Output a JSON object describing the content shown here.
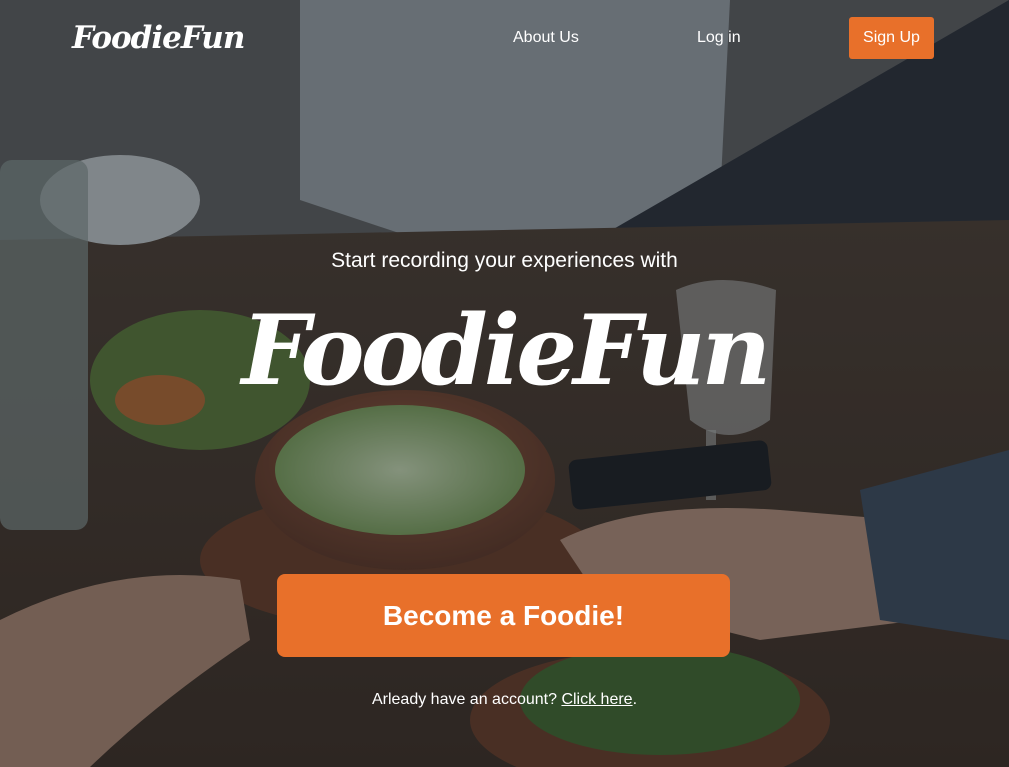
{
  "brand": {
    "name": "FoodieFun",
    "accent_color": "#e8702a",
    "text_color": "#ffffff"
  },
  "nav": {
    "about_label": "About Us",
    "login_label": "Log in",
    "signup_label": "Sign Up"
  },
  "hero": {
    "tagline": "Start recording your experiences with",
    "logo_text": "FoodieFun",
    "cta_label": "Become a Foodie!",
    "login_prompt": "Arleady have an account? ",
    "login_link": "Click here",
    "login_suffix": "."
  },
  "background": {
    "description_icon": "food-table-photo"
  }
}
